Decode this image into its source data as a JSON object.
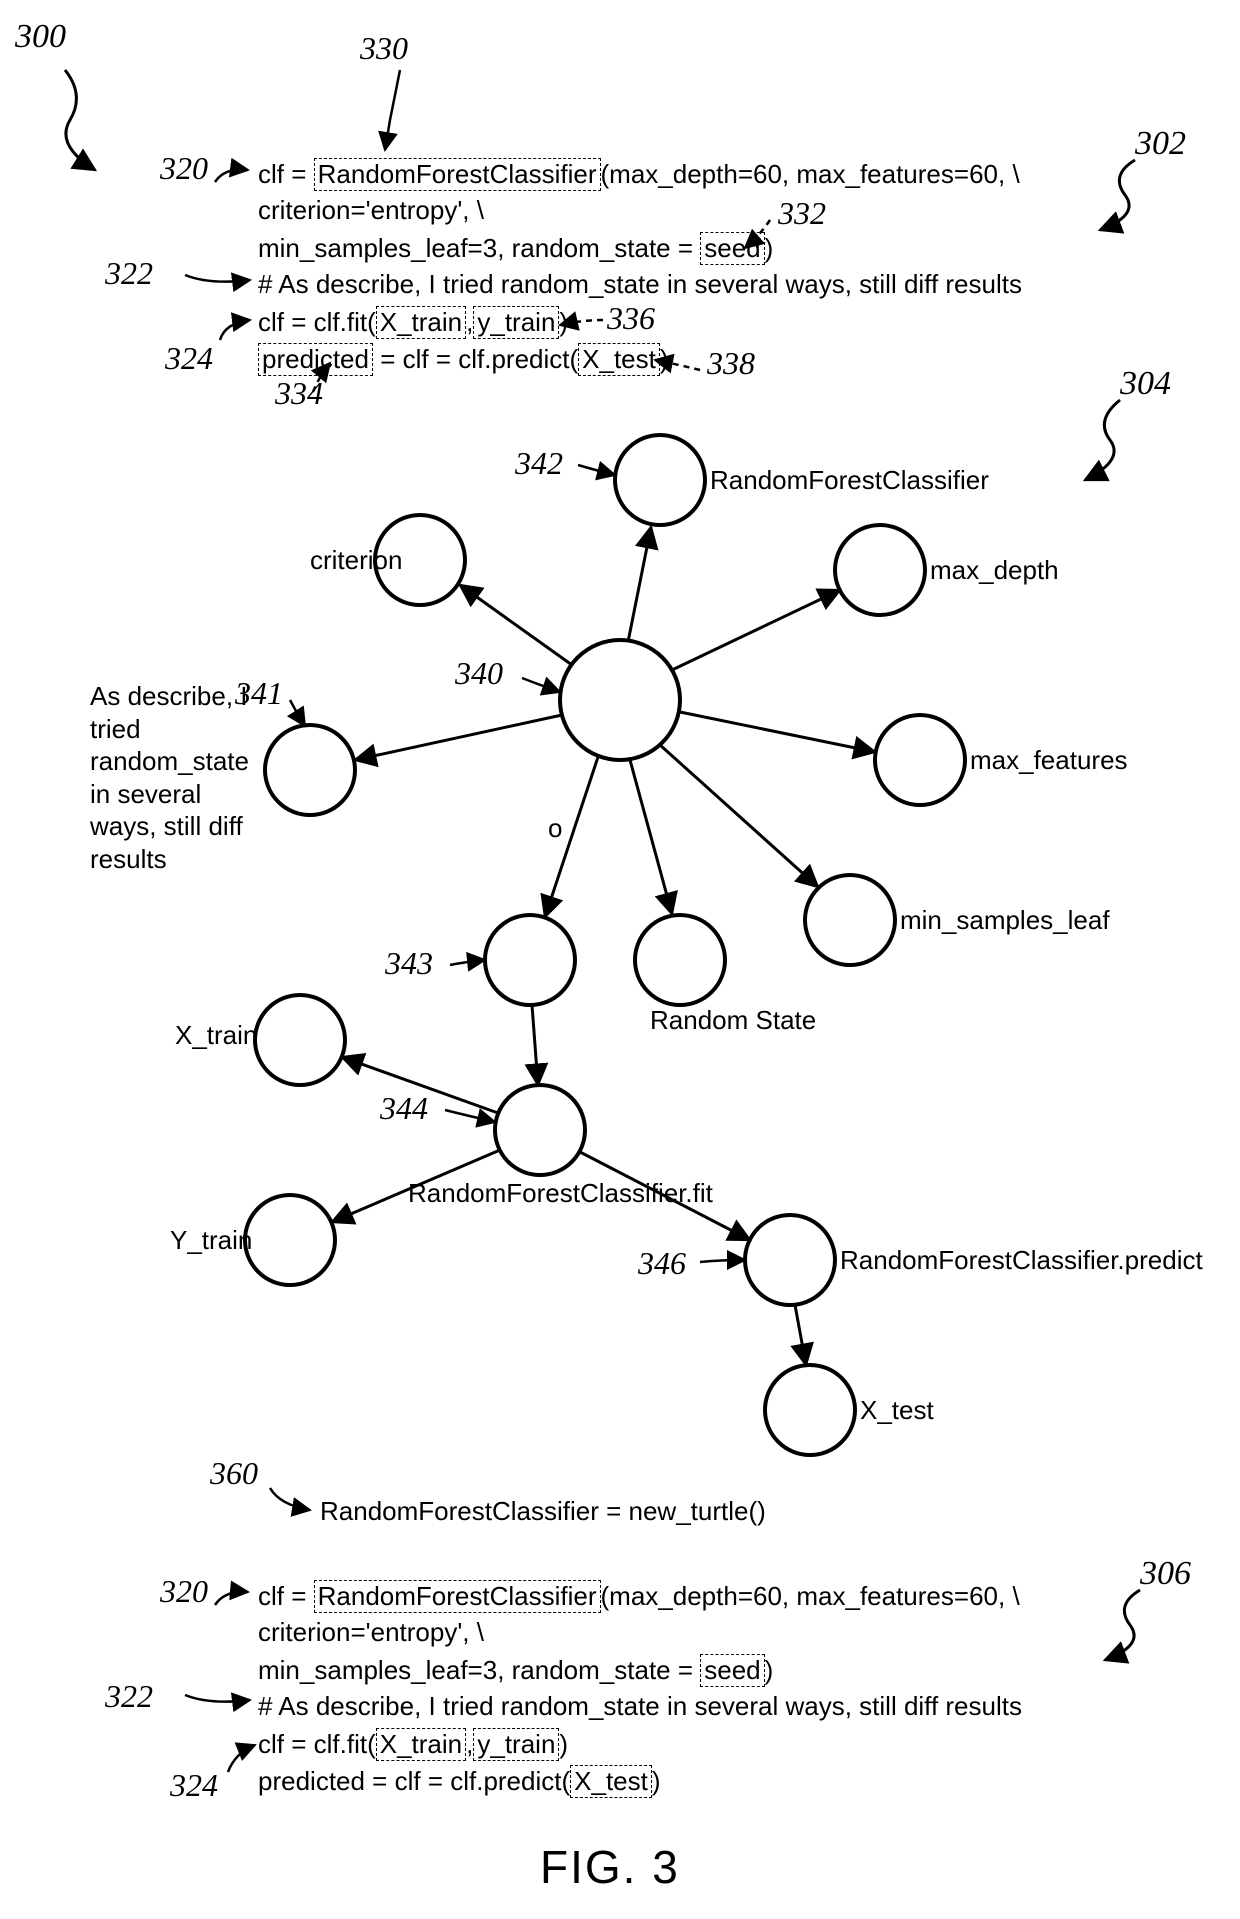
{
  "figure_label": "FIG. 3",
  "refs": {
    "r300": "300",
    "r302": "302",
    "r304": "304",
    "r306": "306",
    "r320a": "320",
    "r322a": "322",
    "r324a": "324",
    "r330": "330",
    "r332": "332",
    "r334": "334",
    "r336": "336",
    "r338": "338",
    "r340": "340",
    "r341": "341",
    "r342": "342",
    "r343": "343",
    "r344": "344",
    "r346": "346",
    "r360": "360",
    "r320b": "320",
    "r322b": "322",
    "r324b": "324"
  },
  "code302": {
    "line1_pre": "clf = ",
    "line1_box": "RandomForestClassifier",
    "line1_post": "(max_depth=60, max_features=60, \\",
    "line2": "criterion='entropy', \\",
    "line3_pre": "min_samples_leaf=3, random_state = ",
    "line3_box": "seed",
    "line3_post": ")",
    "comment": "# As describe, I tried random_state in several ways, still diff results",
    "line5_pre": "clf = clf.fit(",
    "line5_box1": "X_train",
    "line5_mid": ",",
    "line5_box2": "y_train",
    "line5_post": ")",
    "line6_pre1": "predicted",
    "line6_mid": " = clf = clf.predict(",
    "line6_box": "X_test",
    "line6_post": ")"
  },
  "graph_labels": {
    "rfc": "RandomForestClassifier",
    "criterion": "criterion",
    "max_depth": "max_depth",
    "max_features": "max_features",
    "min_samples_leaf": "min_samples_leaf",
    "random_state": "Random State",
    "comment": "As describe, I tried random_state in several ways, still diff results",
    "x_train": "X_train",
    "y_train": "Y_train",
    "fit": "RandomForestClassifier.fit",
    "predict": "RandomForestClassifier.predict",
    "x_test": "X_test",
    "edge_o": "o"
  },
  "line360": "RandomForestClassifier = new_turtle()",
  "code306": {
    "line1_pre": "clf = ",
    "line1_box": "RandomForestClassifier",
    "line1_post": "(max_depth=60, max_features=60, \\",
    "line2": "criterion='entropy', \\",
    "line3_pre": "min_samples_leaf=3, random_state = ",
    "line3_box": "seed",
    "line3_post": ")",
    "comment": "# As describe, I tried random_state in several ways, still diff results",
    "line5_pre": "clf = clf.fit(",
    "line5_box1": "X_train",
    "line5_mid": ",",
    "line5_box2": "y_train",
    "line5_post": ")",
    "line6_pre": "predicted = clf = clf.predict(",
    "line6_box": "X_test",
    "line6_post": ")"
  }
}
